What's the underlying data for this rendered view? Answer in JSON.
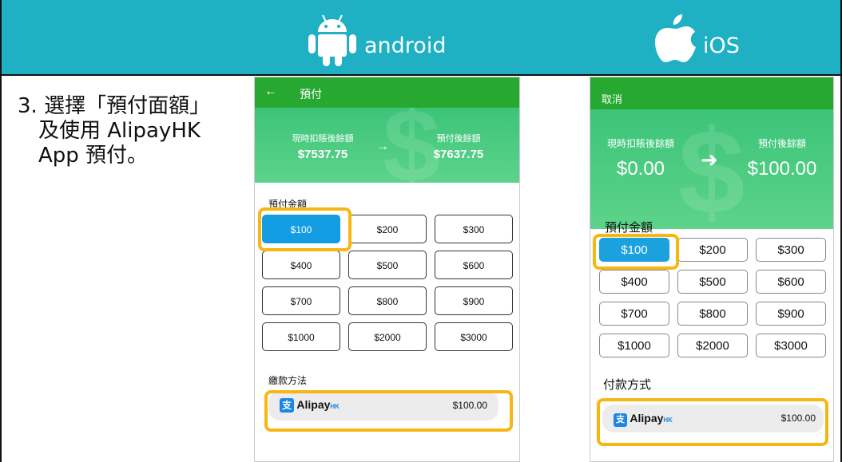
{
  "header": {
    "android_label": "android",
    "ios_label": "iOS"
  },
  "instruction": {
    "line1": "3. 選擇「預付面額」",
    "line2": "及使用 AlipayHK",
    "line3": "App 預付。"
  },
  "android": {
    "back_icon": "←",
    "title": "預付",
    "current_label": "現時扣賬後餘額",
    "current_value": "$7537.75",
    "arrow": "→",
    "after_label": "預付後餘額",
    "after_value": "$7637.75",
    "amount_section": "預付金額",
    "amounts": [
      "$100",
      "$200",
      "$300",
      "$400",
      "$500",
      "$600",
      "$700",
      "$800",
      "$900",
      "$1000",
      "$2000",
      "$3000"
    ],
    "selected_amount": "$100",
    "payment_section": "繳款方法",
    "payment_method": "Alipay",
    "payment_suffix": "HK",
    "payment_amount": "$100.00"
  },
  "ios": {
    "cancel": "取消",
    "current_label": "現時扣賬後餘額",
    "current_value": "$0.00",
    "arrow": "➜",
    "after_label": "預付後餘額",
    "after_value": "$100.00",
    "amount_section": "預付金額",
    "amounts": [
      "$100",
      "$200",
      "$300",
      "$400",
      "$500",
      "$600",
      "$700",
      "$800",
      "$900",
      "$1000",
      "$2000",
      "$3000"
    ],
    "selected_amount": "$100",
    "payment_section": "付款方式",
    "payment_method": "Alipay",
    "payment_suffix": "HK",
    "payment_amount": "$100.00"
  },
  "colors": {
    "header_bg": "#1fb0c4",
    "appbar_green": "#27a831",
    "selected_blue": "#149ce3",
    "highlight_yellow": "#f7b614",
    "alipay_blue": "#1b86e3"
  },
  "icons": {
    "android": "android-robot-icon",
    "ios": "apple-logo-icon"
  }
}
